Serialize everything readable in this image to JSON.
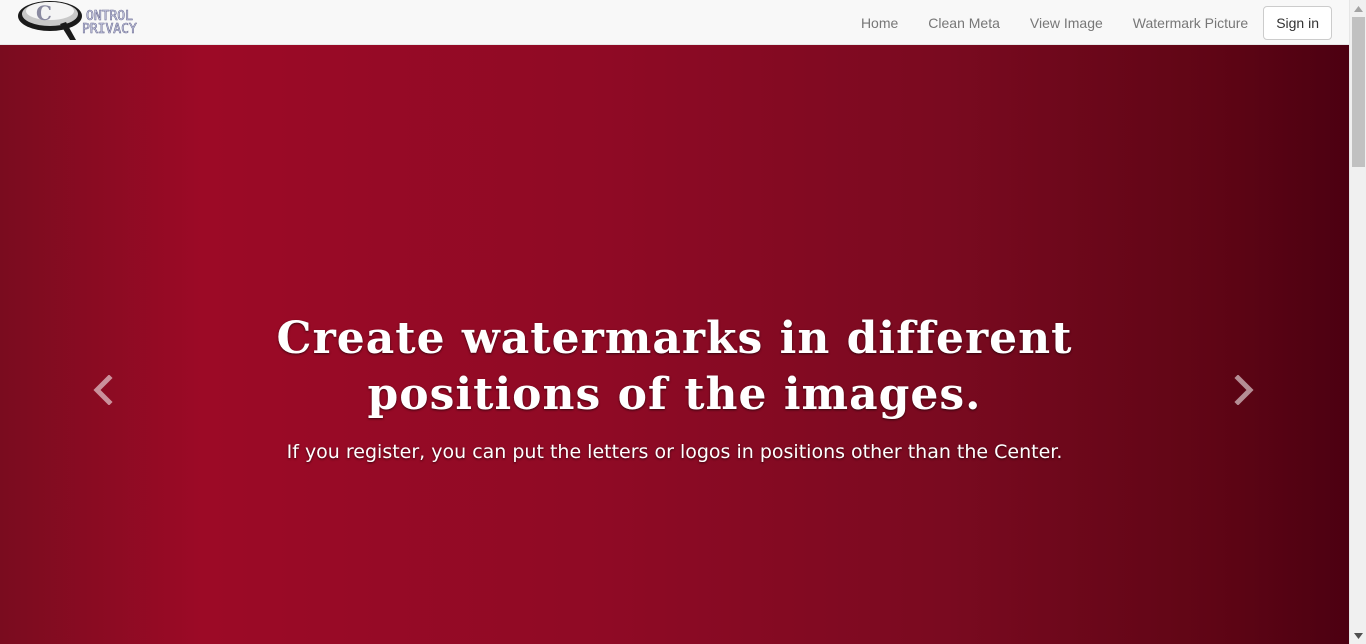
{
  "navbar": {
    "logo_alt": "Control Privacy",
    "links": [
      {
        "label": "Home"
      },
      {
        "label": "Clean Meta"
      },
      {
        "label": "View Image"
      },
      {
        "label": "Watermark Picture"
      }
    ],
    "signin_label": "Sign in"
  },
  "carousel": {
    "title": "Create watermarks in different positions of the images.",
    "text": "If you register, you can put the letters or logos in positions other than the Center.",
    "prev_icon": "chevron-left-icon",
    "next_icon": "chevron-right-icon"
  },
  "colors": {
    "navbar_bg": "#f8f8f8",
    "carousel_dark": "#4c0011",
    "carousel_red": "#9c0a26",
    "link": "#777777"
  }
}
